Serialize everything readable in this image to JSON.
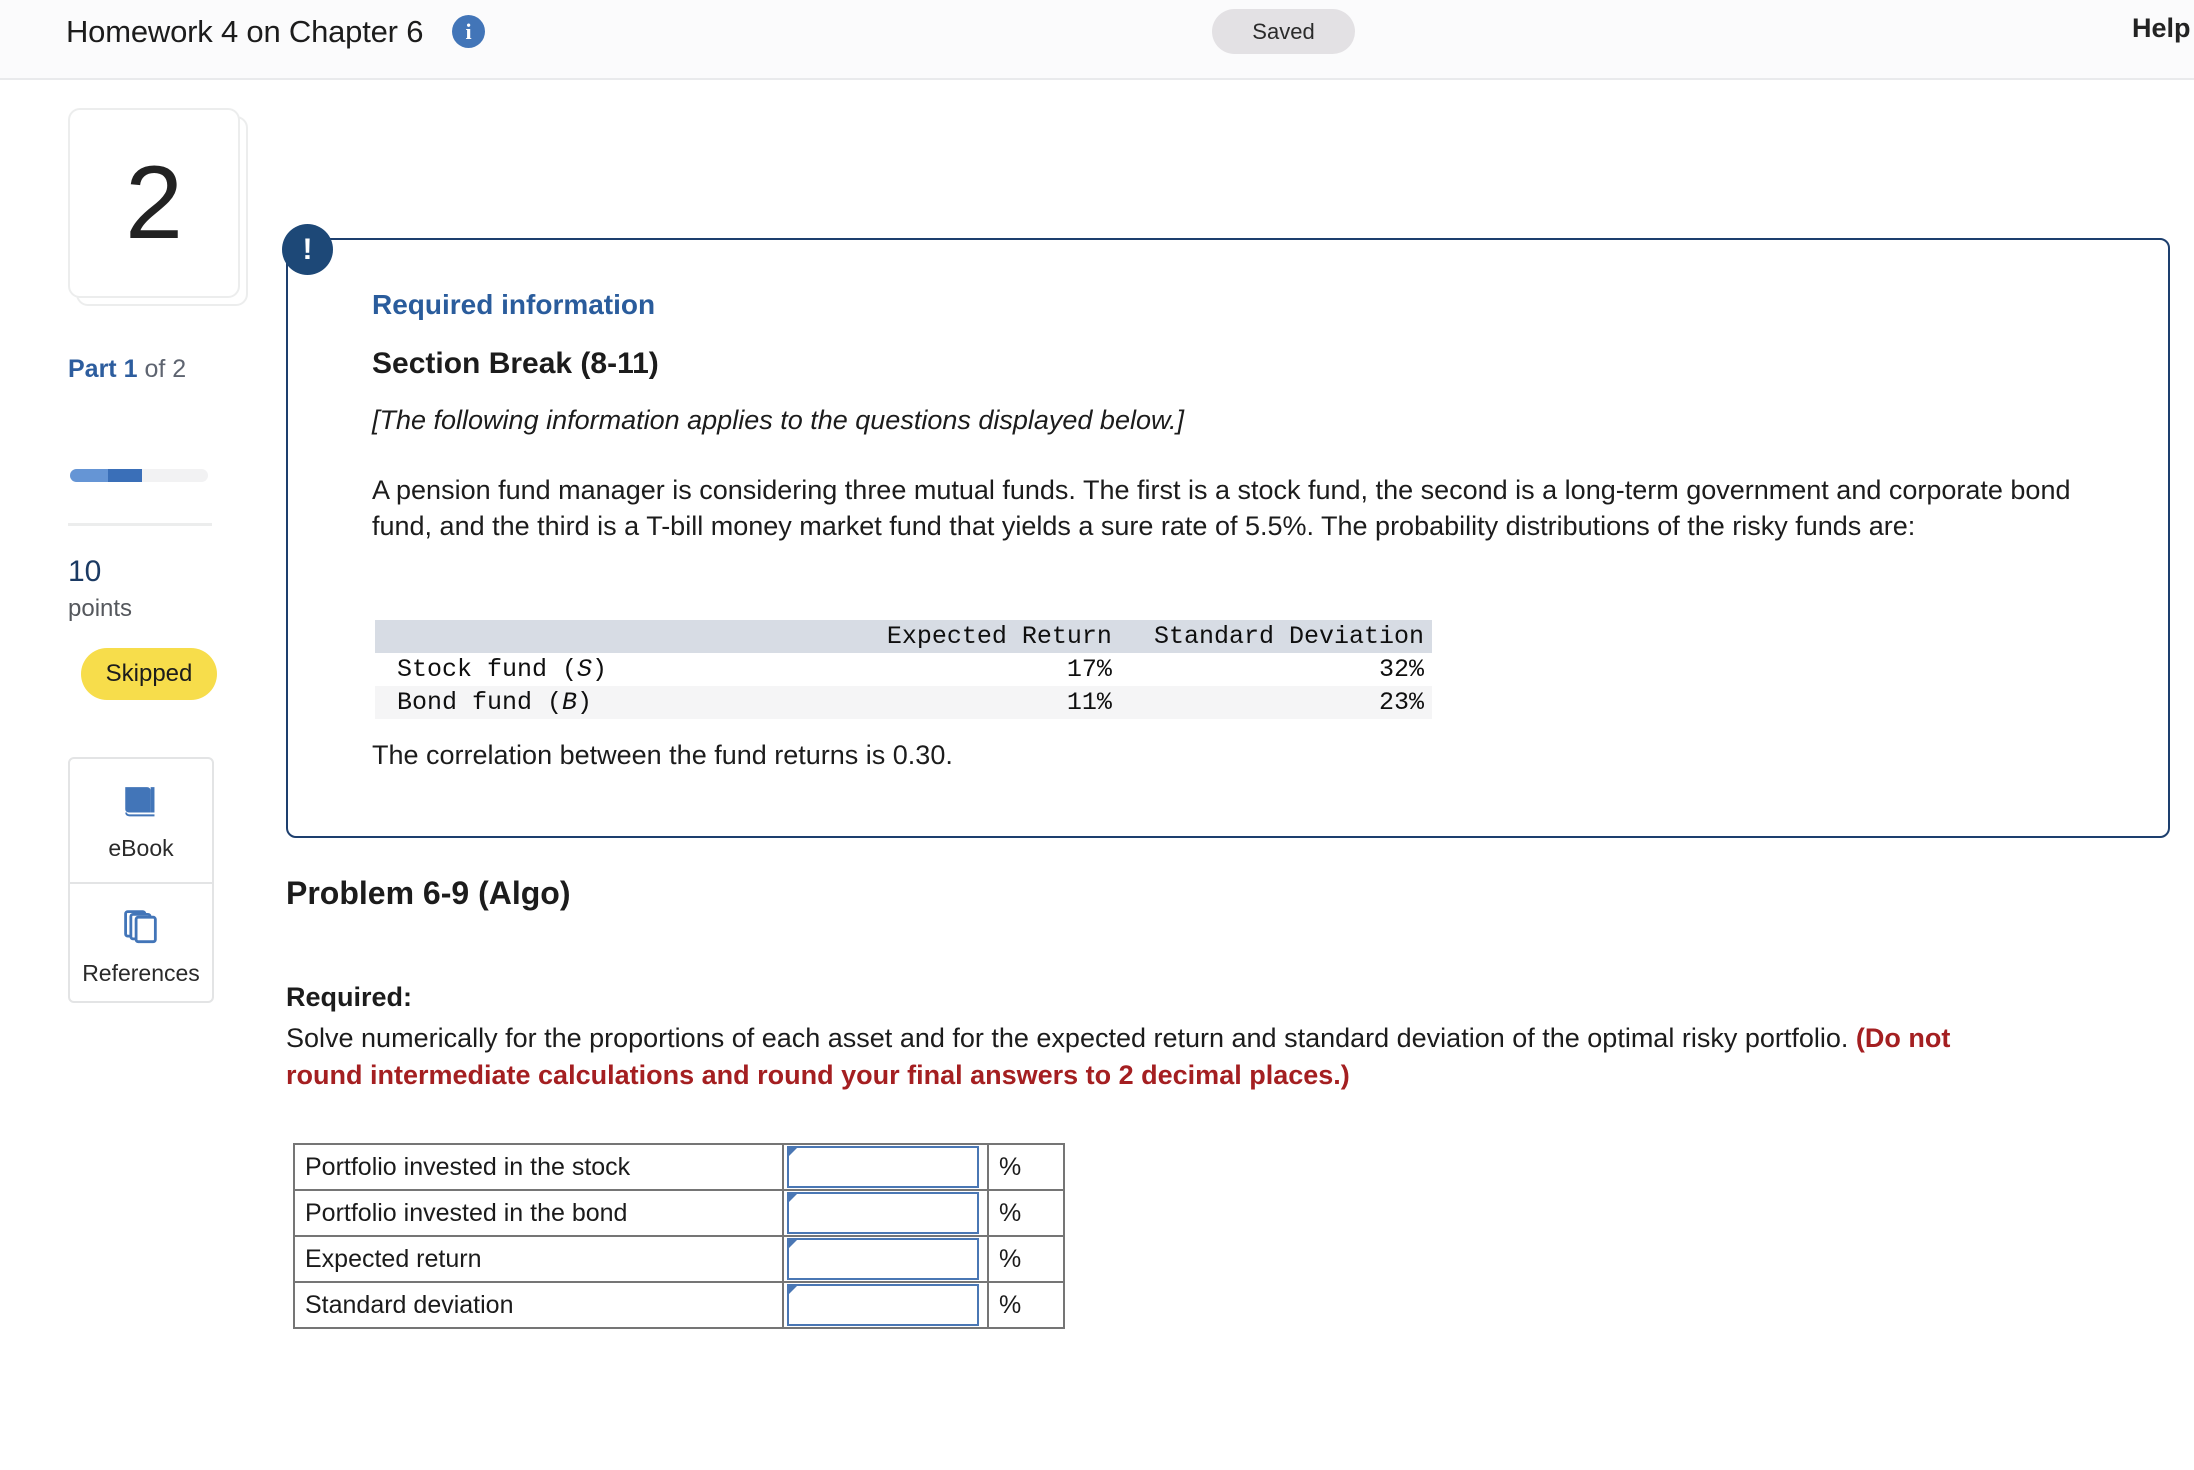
{
  "topbar": {
    "title": "Homework 4 on Chapter 6",
    "info_icon": "info-icon",
    "saved_label": "Saved",
    "help_label": "Help"
  },
  "rail": {
    "question_number": "2",
    "part_prefix": "Part ",
    "part_current": "1",
    "part_suffix": " of 2",
    "progress_percent": 52,
    "points_value": "10",
    "points_label": "points",
    "status_badge": "Skipped",
    "tools": [
      {
        "icon": "book-icon",
        "label": "eBook"
      },
      {
        "icon": "pages-stack-icon",
        "label": "References"
      }
    ]
  },
  "callout": {
    "icon": "exclamation-icon",
    "required_info_label": "Required information",
    "section_break_title": "Section Break (8-11)",
    "applies_note": "[The following information applies to the questions displayed below.]",
    "body_paragraph": "A pension fund manager is considering three mutual funds. The first is a stock fund, the second is a long-term government and corporate bond fund, and the third is a T-bill money market fund that yields a sure rate of 5.5%. The probability distributions of the risky funds are:",
    "correlation_text": "The correlation between the fund returns is 0.30."
  },
  "fund_table": {
    "headers": [
      "",
      "Expected Return",
      "Standard Deviation"
    ],
    "rows": [
      {
        "name": "Stock fund (",
        "symbol": "S",
        "name_end": ")",
        "expected_return": "17%",
        "std_dev": "32%"
      },
      {
        "name": "Bond fund (",
        "symbol": "B",
        "name_end": ")",
        "expected_return": "11%",
        "std_dev": "23%"
      }
    ]
  },
  "problem": {
    "title": "Problem 6-9 (Algo)",
    "required_heading": "Required:",
    "required_text": "Solve numerically for the proportions of each asset and for the expected return and standard deviation of the optimal risky portfolio. ",
    "required_red_note": "(Do not round intermediate calculations and round your final answers to 2 decimal places.)"
  },
  "answer_table": {
    "unit": "%",
    "rows": [
      {
        "label": "Portfolio invested in the stock",
        "value": "",
        "unit": "%"
      },
      {
        "label": "Portfolio invested in the bond",
        "value": "",
        "unit": "%"
      },
      {
        "label": "Expected return",
        "value": "",
        "unit": "%"
      },
      {
        "label": "Standard deviation",
        "value": "",
        "unit": "%"
      }
    ]
  },
  "colors": {
    "accent_blue": "#2a5c9c",
    "callout_border": "#1d3f6e",
    "skipped_yellow": "#f7dd4b",
    "red_note": "#a41f21",
    "input_border": "#4a77b4"
  }
}
